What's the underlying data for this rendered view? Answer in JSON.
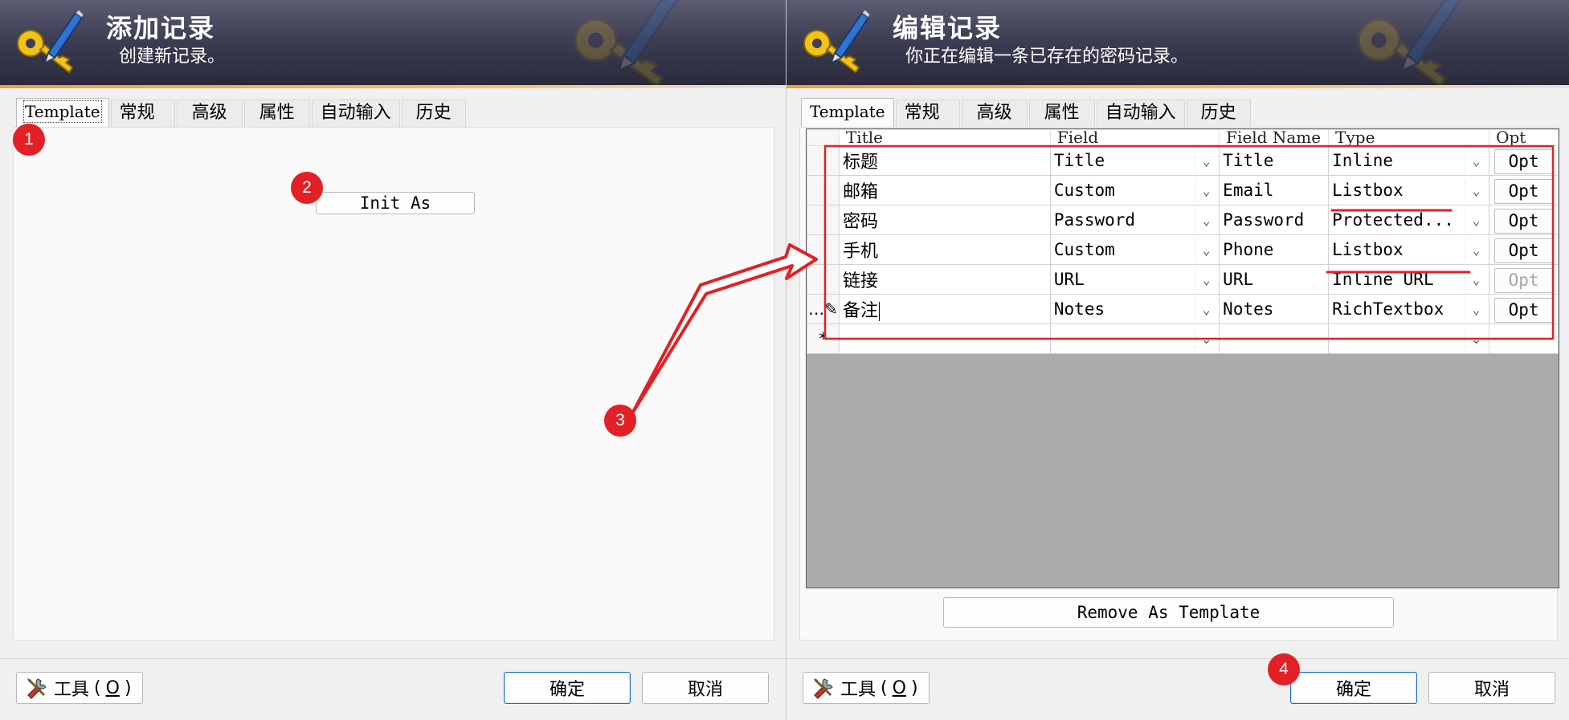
{
  "left_dialog": {
    "title": "添加记录",
    "subtitle": "创建新记录。",
    "tabs": [
      {
        "label": "Template",
        "active": true
      },
      {
        "label": "常规",
        "active": false
      },
      {
        "label": "高级",
        "active": false
      },
      {
        "label": "属性",
        "active": false
      },
      {
        "label": "自动输入",
        "active": false
      },
      {
        "label": "历史",
        "active": false
      }
    ],
    "init_as_label": "Init As",
    "tools_label": "工具",
    "tools_shortcut": "O",
    "ok_label": "确定",
    "cancel_label": "取消"
  },
  "right_dialog": {
    "title": "编辑记录",
    "subtitle": "你正在编辑一条已存在的密码记录。",
    "tabs": [
      {
        "label": "Template",
        "active": true
      },
      {
        "label": "常规",
        "active": false
      },
      {
        "label": "高级",
        "active": false
      },
      {
        "label": "属性",
        "active": false
      },
      {
        "label": "自动输入",
        "active": false
      },
      {
        "label": "历史",
        "active": false
      }
    ],
    "grid": {
      "columns": [
        "Title",
        "Field",
        "Field Name",
        "Type",
        "Opt"
      ],
      "rows": [
        {
          "title": "标题",
          "field": "Title",
          "field_name": "Title",
          "type": "Inline",
          "opt": "Opt",
          "opt_enabled": true,
          "row_marker": ""
        },
        {
          "title": "邮箱",
          "field": "Custom",
          "field_name": "Email",
          "type": "Listbox",
          "opt": "Opt",
          "opt_enabled": true,
          "row_marker": ""
        },
        {
          "title": "密码",
          "field": "Password",
          "field_name": "Password",
          "type": "Protected...",
          "opt": "Opt",
          "opt_enabled": true,
          "row_marker": ""
        },
        {
          "title": "手机",
          "field": "Custom",
          "field_name": "Phone",
          "type": "Listbox",
          "opt": "Opt",
          "opt_enabled": true,
          "row_marker": ""
        },
        {
          "title": "链接",
          "field": "URL",
          "field_name": "URL",
          "type": "Inline URL",
          "opt": "Opt",
          "opt_enabled": false,
          "row_marker": ""
        },
        {
          "title": "备注",
          "field": "Notes",
          "field_name": "Notes",
          "type": "RichTextbox",
          "opt": "Opt",
          "opt_enabled": true,
          "row_marker": "…✎"
        }
      ],
      "new_row_marker": "*"
    },
    "remove_template_label": "Remove As Template",
    "tools_label": "工具",
    "tools_shortcut": "O",
    "ok_label": "确定",
    "cancel_label": "取消"
  },
  "annotations": {
    "color": "#e32025",
    "badges": [
      "1",
      "2",
      "3",
      "4"
    ]
  },
  "icons": {
    "banner": "key-pen-icon",
    "tools": "wrench-tools-icon",
    "combo": "chevron-down-icon"
  }
}
